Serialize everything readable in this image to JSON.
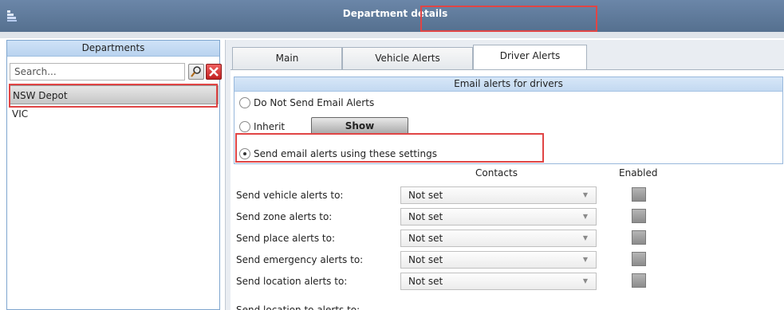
{
  "window": {
    "title": "Department details"
  },
  "departments": {
    "header": "Departments",
    "search_placeholder": "Search...",
    "items": [
      {
        "label": "NSW Depot",
        "selected": true
      },
      {
        "label": "VIC",
        "selected": false
      }
    ]
  },
  "tabs": [
    {
      "label": "Main",
      "active": false
    },
    {
      "label": "Vehicle Alerts",
      "active": false
    },
    {
      "label": "Driver Alerts",
      "active": true
    }
  ],
  "email": {
    "header": "Email alerts for drivers",
    "options": [
      {
        "label": "Do Not Send Email Alerts",
        "selected": false
      },
      {
        "label": "Inherit",
        "selected": false
      },
      {
        "label": "Send email alerts using these settings",
        "selected": true
      }
    ],
    "show_button": "Show"
  },
  "columns": {
    "contacts": "Contacts",
    "enabled": "Enabled"
  },
  "alerts": [
    {
      "label": "Send vehicle alerts to:",
      "value": "Not set",
      "enabled": false
    },
    {
      "label": "Send zone alerts to:",
      "value": "Not set",
      "enabled": false
    },
    {
      "label": "Send place alerts to:",
      "value": "Not set",
      "enabled": false
    },
    {
      "label": "Send emergency alerts to:",
      "value": "Not set",
      "enabled": false
    },
    {
      "label": "Send location alerts to:",
      "value": "Not set",
      "enabled": false
    }
  ],
  "cut_off_label": "Send location to alerts to:",
  "colors": {
    "highlight": "#e04545",
    "titlebar": "#5f7a9c",
    "panel_header": "#c3d9f1"
  }
}
